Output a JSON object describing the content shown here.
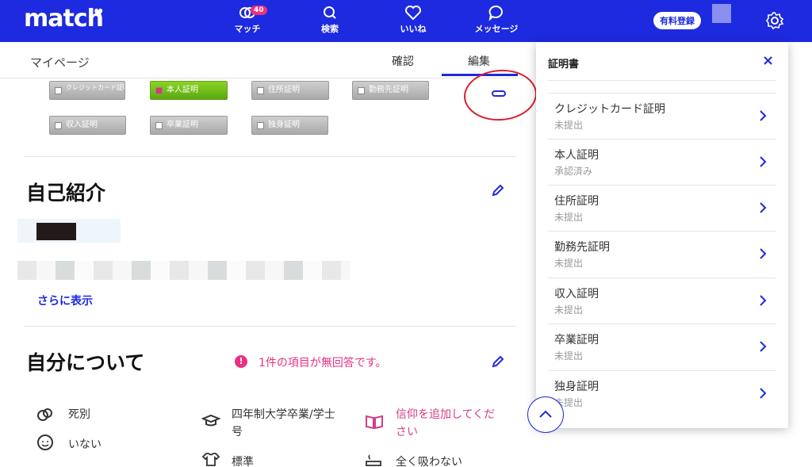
{
  "header": {
    "logo": "match",
    "nav": [
      {
        "label": "マッチ",
        "badge": "40",
        "icon": "match-icon"
      },
      {
        "label": "検索",
        "icon": "search-icon"
      },
      {
        "label": "いいね",
        "icon": "heart-icon"
      },
      {
        "label": "メッセージ",
        "icon": "message-icon"
      }
    ],
    "paid_button": "有料登録",
    "settings_icon": "gear-icon"
  },
  "subheader": {
    "title": "マイページ",
    "tabs": [
      "確認",
      "編集"
    ],
    "active_tab": "編集"
  },
  "certificates_chips": [
    {
      "label": "クレジットカード証明",
      "active": false
    },
    {
      "label": "本人証明",
      "active": true
    },
    {
      "label": "住所証明",
      "active": false
    },
    {
      "label": "勤務先証明",
      "active": false
    },
    {
      "label": "収入証明",
      "active": false
    },
    {
      "label": "卒業証明",
      "active": false
    },
    {
      "label": "独身証明",
      "active": false
    }
  ],
  "intro": {
    "heading": "自己紹介",
    "more_link": "さらに表示"
  },
  "about": {
    "heading": "自分について",
    "warning": "1件の項目が無回答です。",
    "col1": [
      "死別",
      "いない"
    ],
    "col2": [
      "四年制大学卒業/学士号",
      "標準"
    ],
    "col3": [
      "信仰を追加してください",
      "全く吸わない"
    ]
  },
  "panel": {
    "title": "証明書",
    "close": "×",
    "items": [
      {
        "name": "クレジットカード証明",
        "status": "未提出"
      },
      {
        "name": "本人証明",
        "status": "承認済み"
      },
      {
        "name": "住所証明",
        "status": "未提出"
      },
      {
        "name": "勤務先証明",
        "status": "未提出"
      },
      {
        "name": "収入証明",
        "status": "未提出"
      },
      {
        "name": "卒業証明",
        "status": "未提出"
      },
      {
        "name": "独身証明",
        "status": "未提出"
      }
    ]
  },
  "colors": {
    "brand": "#1d2adf",
    "accent_pink": "#e9317f",
    "chip_active": "#6fbd1a"
  }
}
